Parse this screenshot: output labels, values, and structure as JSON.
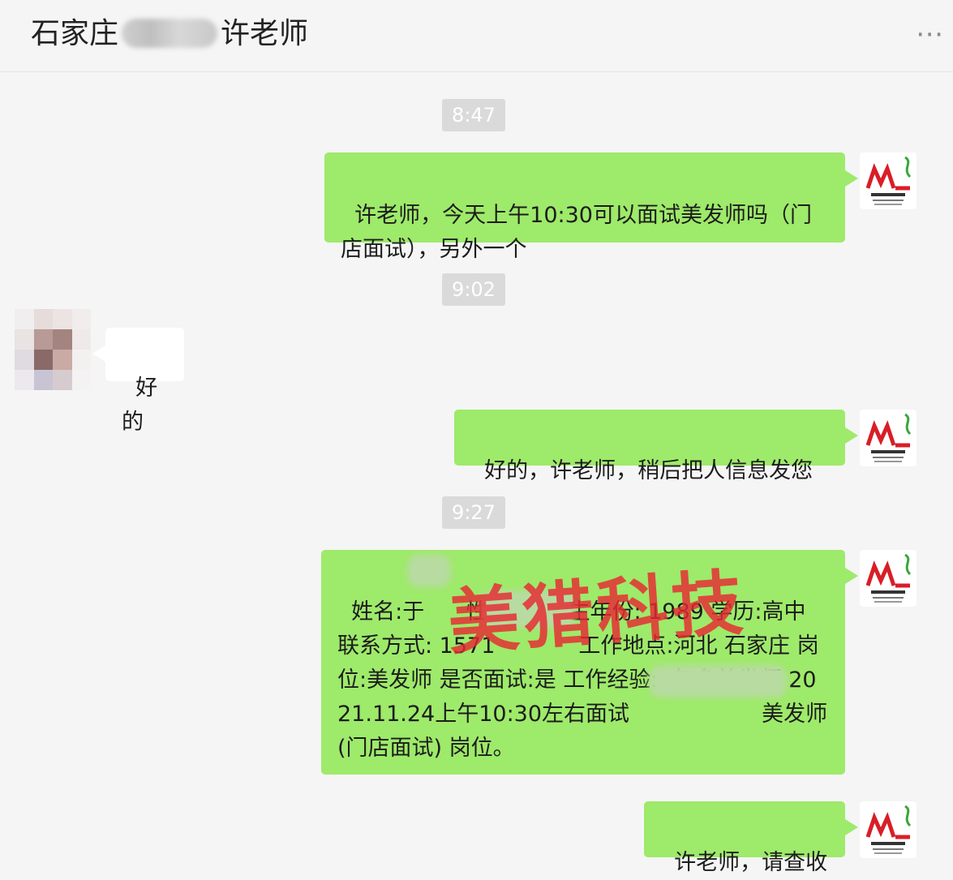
{
  "header": {
    "title_prefix": "石家庄",
    "title_suffix": "许老师",
    "more_icon": "⋯"
  },
  "messages": [
    {
      "type": "time",
      "text": "8:47"
    },
    {
      "type": "sent",
      "text": "许老师，今天上午10:30可以面试美发师吗（门店面试），另外一个"
    },
    {
      "type": "time",
      "text": "9:02"
    },
    {
      "type": "received",
      "text": "好的"
    },
    {
      "type": "sent",
      "text": "好的，许老师，稍后把人信息发您"
    },
    {
      "type": "time",
      "text": "9:27"
    },
    {
      "type": "sent",
      "text": "姓名:于      性别:男 出生年份: 1989 学历:高中 联系方式: 1571            工作地点:河北 石家庄 岗位:美发师 是否面试:是 工作经验:2年多美发师 2021.11.24上午10:30左右面试                   美发师(门店面试) 岗位。"
    },
    {
      "type": "sent",
      "text": "许老师，请查收"
    }
  ],
  "watermark": "美猎科技",
  "colors": {
    "sent_bubble": "#9eea6a",
    "received_bubble": "#ffffff",
    "background": "#f5f5f5",
    "time_badge": "#dadada",
    "watermark": "#e62832"
  },
  "icons": {
    "contact_avatar": "blurred-person-avatar",
    "self_avatar": "meilie-logo-avatar"
  }
}
